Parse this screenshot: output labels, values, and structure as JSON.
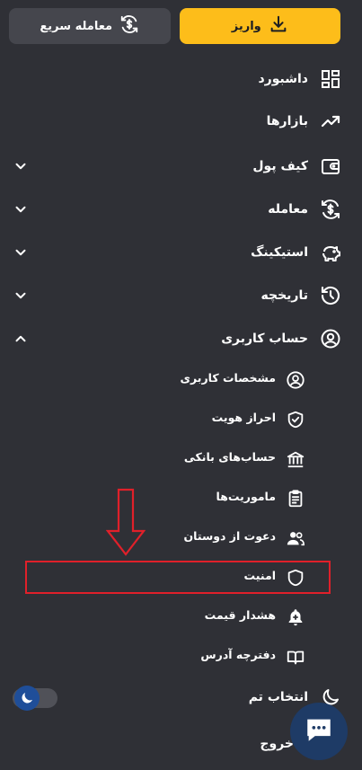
{
  "top_buttons": {
    "deposit_label": "واریز",
    "quick_trade_label": "معامله سریع"
  },
  "menu": {
    "dashboard": "داشبورد",
    "markets": "بازارها",
    "wallet": "کیف پول",
    "trade": "معامله",
    "staking": "استیکینگ",
    "history": "تاریخچه",
    "account": "حساب کاربری",
    "account_sub": {
      "profile": "مشخصات کاربری",
      "kyc": "احراز هویت",
      "bank_accounts": "حساب‌های بانکی",
      "missions": "ماموریت‌ها",
      "invite": "دعوت از دوستان",
      "security": "امنیت",
      "price_alert": "هشدار قیمت",
      "address_book": "دفترچه آدرس"
    },
    "theme": "انتخاب تم",
    "logout": "خروج"
  },
  "colors": {
    "background": "#2f3036",
    "accent": "#fdbd1a",
    "annotation": "#e0202a"
  }
}
